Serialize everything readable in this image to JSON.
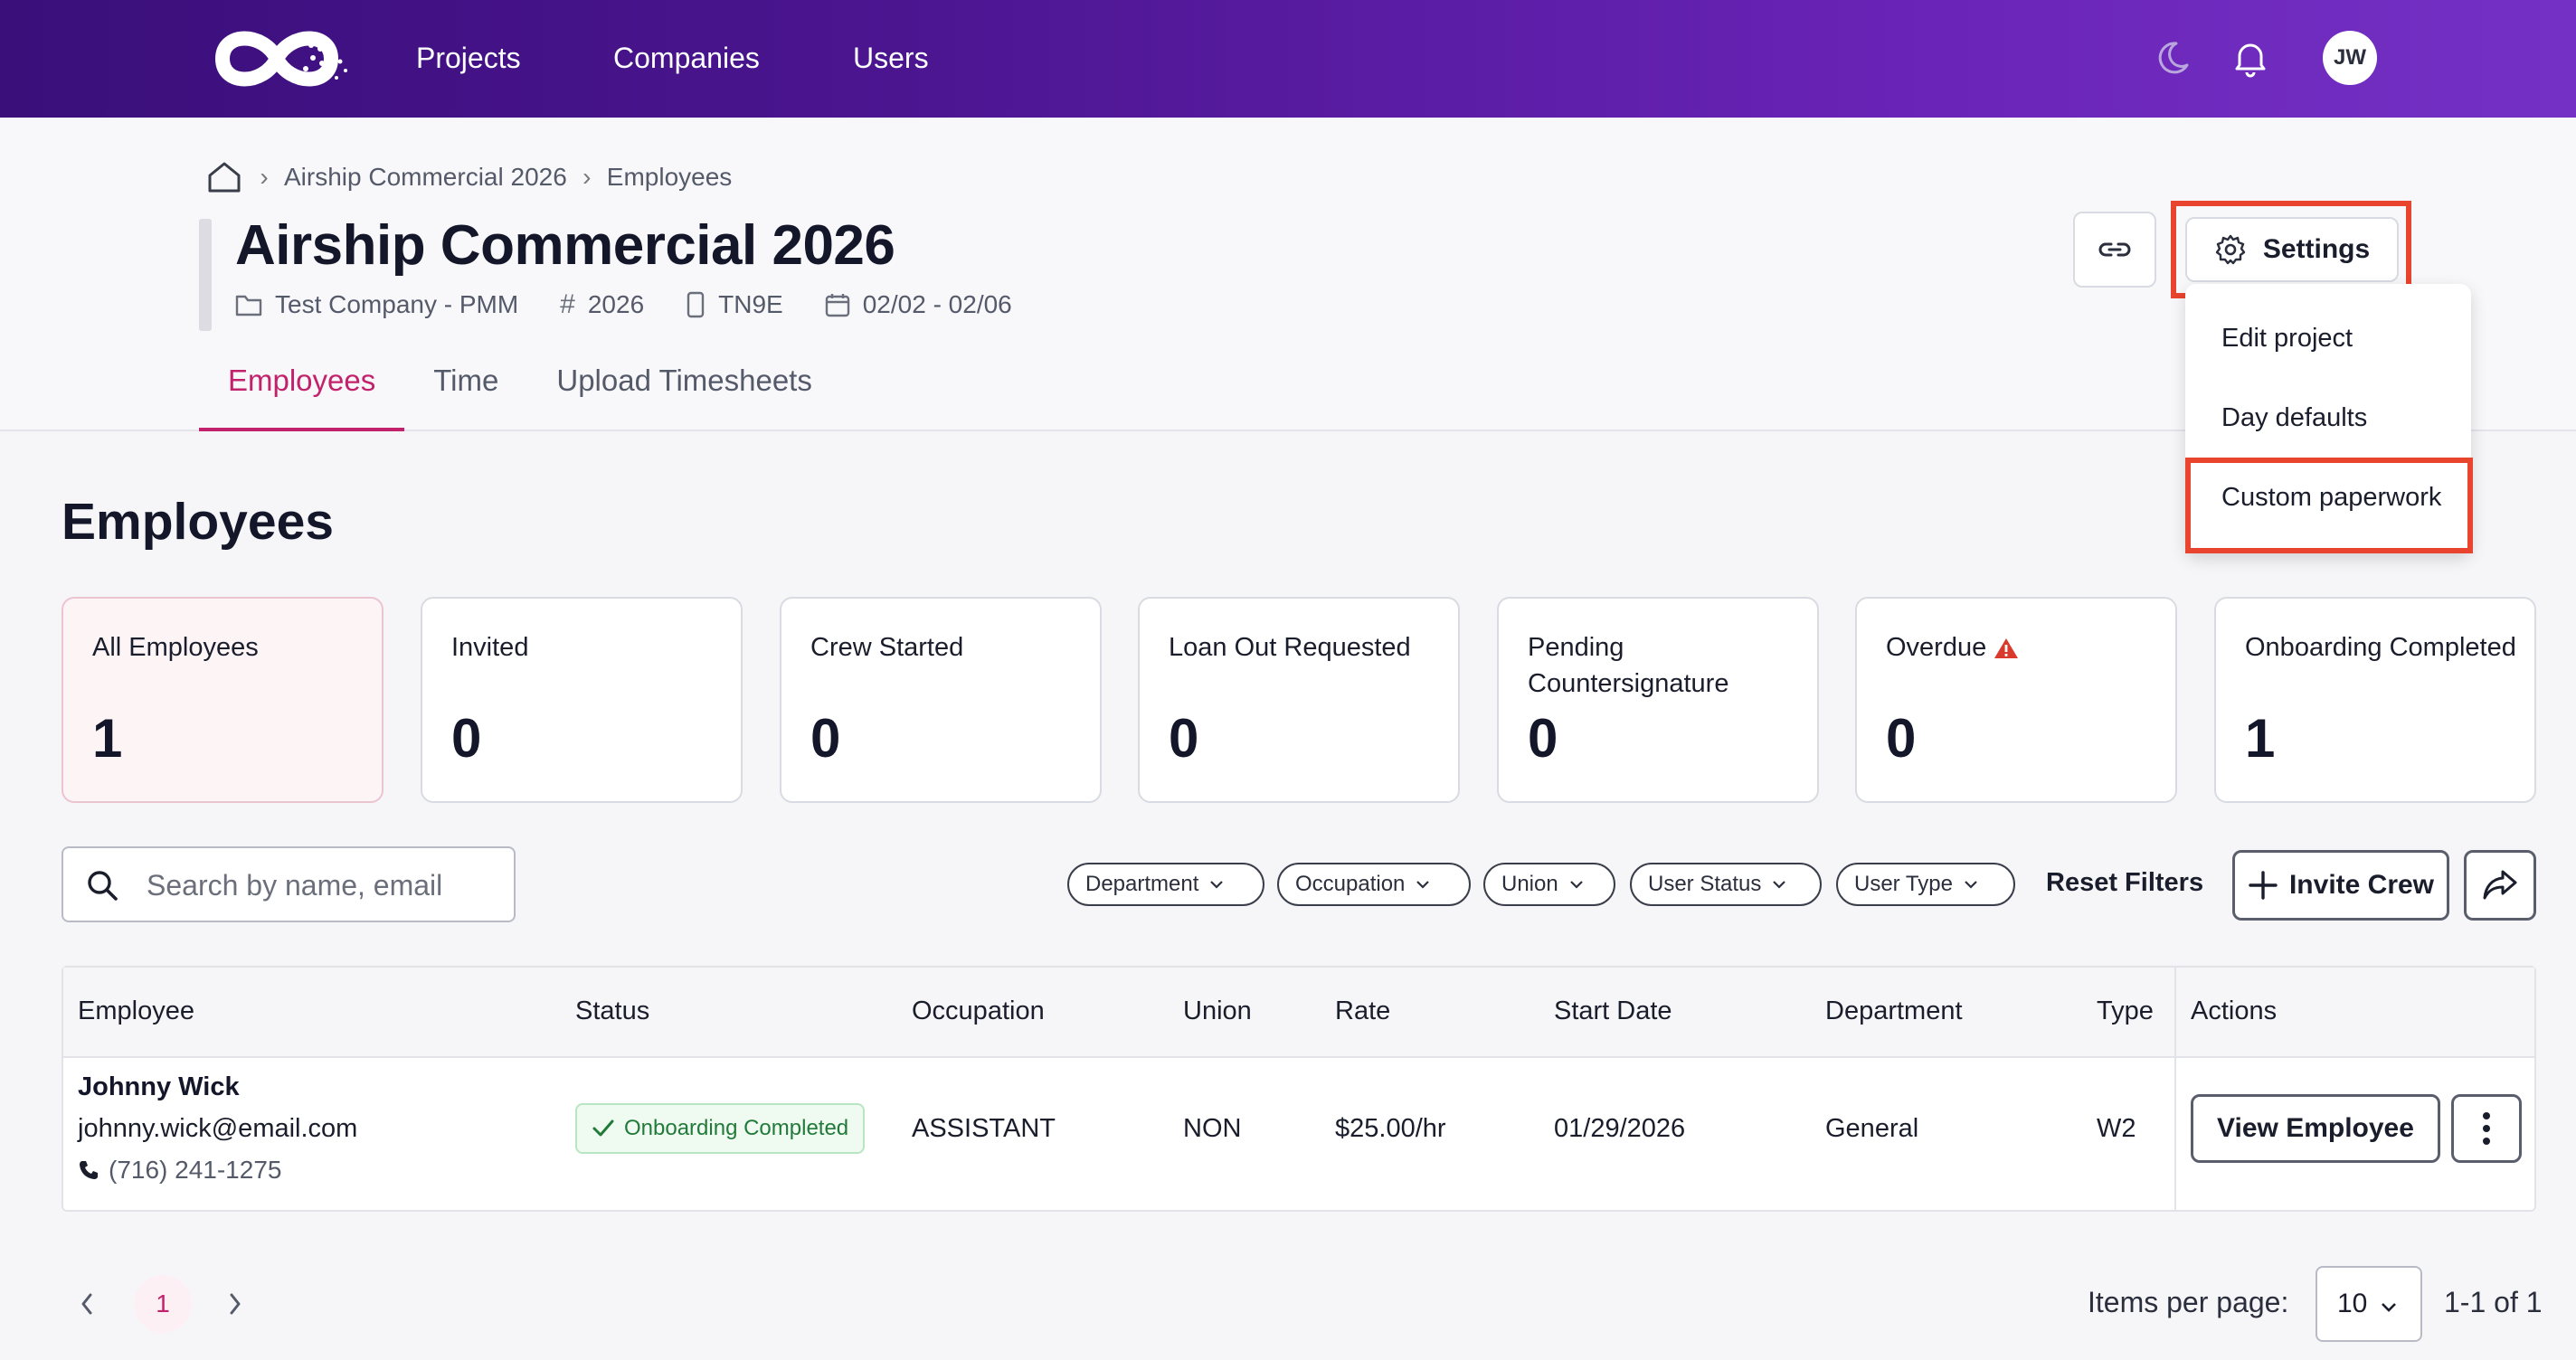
{
  "nav": {
    "links": [
      "Projects",
      "Companies",
      "Users"
    ],
    "avatar_initials": "JW",
    "icons": [
      "moon-icon",
      "bell-icon"
    ]
  },
  "breadcrumb": {
    "items": [
      "Airship Commercial 2026",
      "Employees"
    ]
  },
  "project": {
    "title": "Airship Commercial 2026",
    "company": "Test Company - PMM",
    "number": "2026",
    "code": "TN9E",
    "dates": "02/02 - 02/06"
  },
  "tabs": [
    "Employees",
    "Time",
    "Upload Timesheets"
  ],
  "settings": {
    "label": "Settings",
    "menu": [
      "Edit project",
      "Day defaults",
      "Custom paperwork"
    ]
  },
  "section_title": "Employees",
  "stats": [
    {
      "label": "All Employees",
      "value": "1"
    },
    {
      "label": "Invited",
      "value": "0"
    },
    {
      "label": "Crew Started",
      "value": "0"
    },
    {
      "label": "Loan Out Requested",
      "value": "0"
    },
    {
      "label": "Pending Countersignature",
      "value": "0"
    },
    {
      "label": "Overdue",
      "value": "0"
    },
    {
      "label": "Onboarding Completed",
      "value": "1"
    }
  ],
  "search": {
    "placeholder": "Search by name, email"
  },
  "filters": [
    "Department",
    "Occupation",
    "Union",
    "User Status",
    "User Type"
  ],
  "reset_filters": "Reset Filters",
  "invite_label": "Invite Crew",
  "table": {
    "headers": [
      "Employee",
      "Status",
      "Occupation",
      "Union",
      "Rate",
      "Start Date",
      "Department",
      "Type",
      "Actions"
    ],
    "rows": [
      {
        "name": "Johnny Wick",
        "email": "johnny.wick@email.com",
        "phone": "(716) 241-1275",
        "status": "Onboarding Completed",
        "occupation": "ASSISTANT",
        "union": "NON",
        "rate": "$25.00/hr",
        "start_date": "01/29/2026",
        "department": "General",
        "type": "W2",
        "action": "View Employee"
      }
    ]
  },
  "pagination": {
    "current_page": "1",
    "items_per_page_label": "Items per page:",
    "items_per_page": "10",
    "range": "1-1 of 1"
  },
  "colors": {
    "accent": "#c2216b",
    "highlight": "#e8442e",
    "nav_start": "#3a0f7a",
    "nav_end": "#7430c4",
    "success": "#227a3a"
  }
}
